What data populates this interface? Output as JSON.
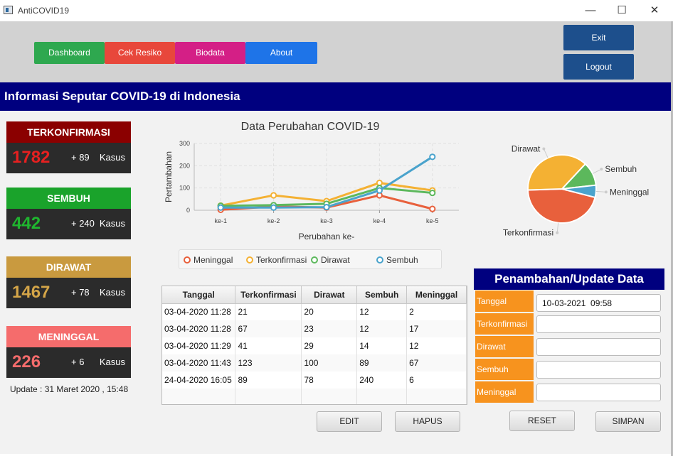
{
  "window": {
    "title": "AntiCOVID19",
    "controls": [
      "—",
      "☐",
      "✕"
    ]
  },
  "nav": {
    "buttons": [
      {
        "label": "Dashboard",
        "color": "#2ea84f"
      },
      {
        "label": "Cek Resiko",
        "color": "#e8473b"
      },
      {
        "label": "Biodata",
        "color": "#d41f86"
      },
      {
        "label": "About",
        "color": "#1e74e8"
      }
    ],
    "exit_label": "Exit",
    "logout_label": "Logout"
  },
  "banner": {
    "title": "Informasi Seputar COVID-19 di Indonesia"
  },
  "cards": [
    {
      "header": "TERKONFIRMASI",
      "value": "1782",
      "delta": "+ 89",
      "unit": "Kasus",
      "header_color": "#8b0000",
      "value_color": "#e62020"
    },
    {
      "header": "SEMBUH",
      "value": "442",
      "delta": "+ 240",
      "unit": "Kasus",
      "header_color": "#1aa32b",
      "value_color": "#1fb62f"
    },
    {
      "header": "DIRAWAT",
      "value": "1467",
      "delta": "+ 78",
      "unit": "Kasus",
      "header_color": "#c99a3f",
      "value_color": "#d4a548"
    },
    {
      "header": "MENINGGAL",
      "value": "226",
      "delta": "+ 6",
      "unit": "Kasus",
      "header_color": "#f56c6c",
      "value_color": "#f56c6c"
    }
  ],
  "update_text": "Update : 31 Maret 2020 , 15:48",
  "chart_data": [
    {
      "type": "line",
      "title": "Data Perubahan COVID-19",
      "xlabel": "Perubahan ke-",
      "ylabel": "Pertambahan",
      "categories": [
        "ke-1",
        "ke-2",
        "ke-3",
        "ke-4",
        "ke-5"
      ],
      "ylim": [
        0,
        300
      ],
      "yticks": [
        0,
        100,
        200,
        300
      ],
      "grid": true,
      "legend_position": "bottom",
      "series": [
        {
          "name": "Meninggal",
          "color": "#e8603c",
          "values": [
            2,
            17,
            12,
            67,
            6
          ]
        },
        {
          "name": "Terkonfirmasi",
          "color": "#f4b133",
          "values": [
            21,
            67,
            41,
            123,
            89
          ]
        },
        {
          "name": "Dirawat",
          "color": "#5cb85c",
          "values": [
            20,
            23,
            29,
            100,
            78
          ]
        },
        {
          "name": "Sembuh",
          "color": "#4aa3cc",
          "values": [
            12,
            12,
            14,
            89,
            240
          ]
        }
      ]
    },
    {
      "type": "pie",
      "slices": [
        {
          "label": "Terkonfirmasi",
          "value": 1782,
          "color": "#e8603c"
        },
        {
          "label": "Dirawat",
          "value": 1467,
          "color": "#f4b133"
        },
        {
          "label": "Sembuh",
          "value": 442,
          "color": "#5cb85c"
        },
        {
          "label": "Meninggal",
          "value": 226,
          "color": "#4aa3cc"
        }
      ]
    }
  ],
  "table": {
    "headers": [
      "Tanggal",
      "Terkonfirmasi",
      "Dirawat",
      "Sembuh",
      "Meninggal"
    ],
    "rows": [
      [
        "03-04-2020  11:28",
        "21",
        "20",
        "12",
        "2"
      ],
      [
        "03-04-2020  11:28",
        "67",
        "23",
        "12",
        "17"
      ],
      [
        "03-04-2020  11:29",
        "41",
        "29",
        "14",
        "12"
      ],
      [
        "03-04-2020  11:43",
        "123",
        "100",
        "89",
        "67"
      ],
      [
        "24-04-2020  16:05",
        "89",
        "78",
        "240",
        "6"
      ]
    ]
  },
  "table_buttons": {
    "edit": "EDIT",
    "hapus": "HAPUS"
  },
  "form": {
    "title": "Penambahan/Update Data",
    "fields": [
      {
        "label": "Tanggal",
        "value": "10-03-2021  09:58"
      },
      {
        "label": "Terkonfirmasi",
        "value": ""
      },
      {
        "label": "Dirawat",
        "value": ""
      },
      {
        "label": "Sembuh",
        "value": ""
      },
      {
        "label": "Meninggal",
        "value": ""
      }
    ],
    "reset_label": "RESET",
    "simpan_label": "SIMPAN"
  }
}
